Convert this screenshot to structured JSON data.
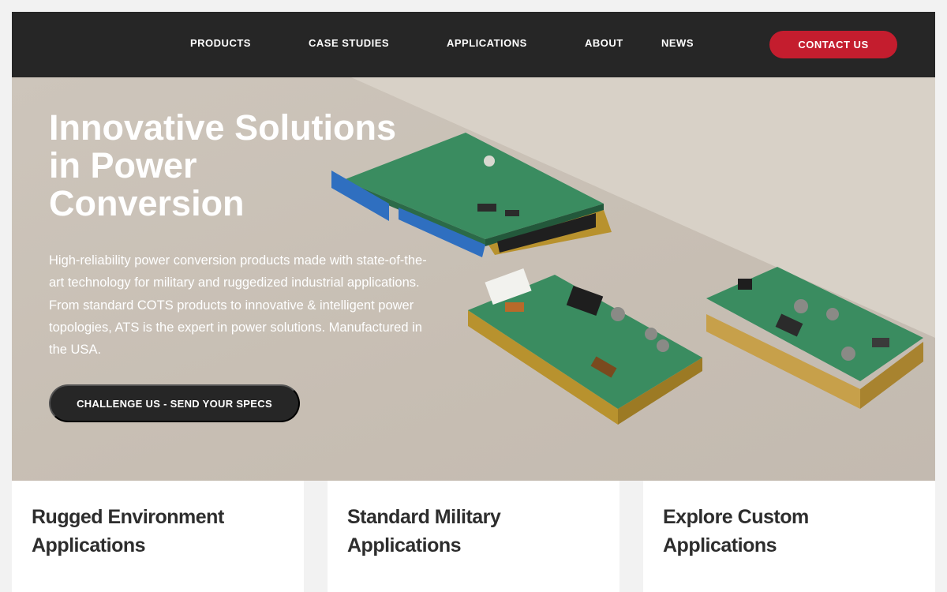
{
  "nav": {
    "items": [
      "PRODUCTS",
      "CASE STUDIES",
      "APPLICATIONS",
      "ABOUT",
      "NEWS"
    ],
    "contact_label": "CONTACT US"
  },
  "hero": {
    "title_lines": [
      "Innovative Solutions",
      "in Power",
      "Conversion"
    ],
    "description": "High-reliability power conversion products made with state-of-the-art technology for military and ruggedized industrial applications. From standard COTS products to innovative & intelligent power topologies, ATS is the expert in power solutions. Manufactured in the USA.",
    "cta_label": "CHALLENGE US - SEND YOUR SPECS"
  },
  "cards": [
    {
      "line1": "Rugged Environment",
      "line2": "Applications"
    },
    {
      "line1": "Standard Military",
      "line2": "Applications"
    },
    {
      "line1": "Explore Custom",
      "line2": "Applications"
    }
  ],
  "colors": {
    "header_bg": "#262626",
    "accent_red": "#c41d2e",
    "hero_bg": "#c7beb3",
    "pcb_green": "#3d8a5e",
    "connector_blue": "#2f6fc0",
    "gold": "#c9a23a"
  }
}
